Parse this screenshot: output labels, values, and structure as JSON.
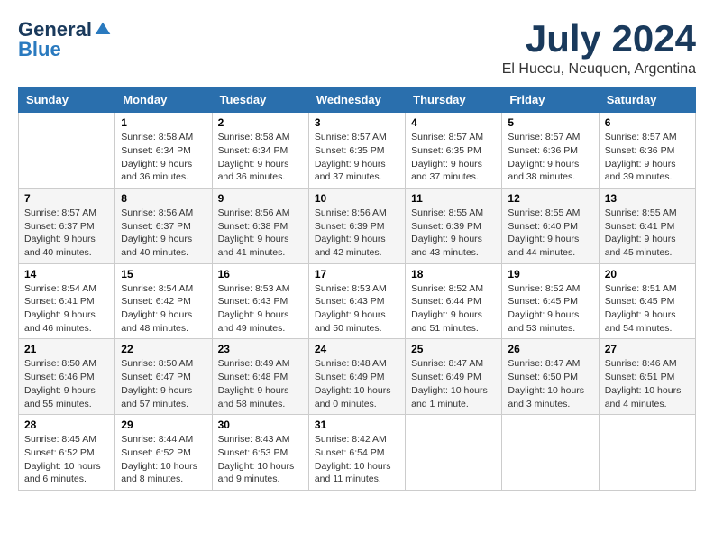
{
  "header": {
    "logo": {
      "general": "General",
      "blue": "Blue"
    },
    "title": "July 2024",
    "location": "El Huecu, Neuquen, Argentina"
  },
  "calendar": {
    "days_of_week": [
      "Sunday",
      "Monday",
      "Tuesday",
      "Wednesday",
      "Thursday",
      "Friday",
      "Saturday"
    ],
    "weeks": [
      [
        {
          "day": "",
          "info": ""
        },
        {
          "day": "1",
          "info": "Sunrise: 8:58 AM\nSunset: 6:34 PM\nDaylight: 9 hours\nand 36 minutes."
        },
        {
          "day": "2",
          "info": "Sunrise: 8:58 AM\nSunset: 6:34 PM\nDaylight: 9 hours\nand 36 minutes."
        },
        {
          "day": "3",
          "info": "Sunrise: 8:57 AM\nSunset: 6:35 PM\nDaylight: 9 hours\nand 37 minutes."
        },
        {
          "day": "4",
          "info": "Sunrise: 8:57 AM\nSunset: 6:35 PM\nDaylight: 9 hours\nand 37 minutes."
        },
        {
          "day": "5",
          "info": "Sunrise: 8:57 AM\nSunset: 6:36 PM\nDaylight: 9 hours\nand 38 minutes."
        },
        {
          "day": "6",
          "info": "Sunrise: 8:57 AM\nSunset: 6:36 PM\nDaylight: 9 hours\nand 39 minutes."
        }
      ],
      [
        {
          "day": "7",
          "info": "Sunrise: 8:57 AM\nSunset: 6:37 PM\nDaylight: 9 hours\nand 40 minutes."
        },
        {
          "day": "8",
          "info": "Sunrise: 8:56 AM\nSunset: 6:37 PM\nDaylight: 9 hours\nand 40 minutes."
        },
        {
          "day": "9",
          "info": "Sunrise: 8:56 AM\nSunset: 6:38 PM\nDaylight: 9 hours\nand 41 minutes."
        },
        {
          "day": "10",
          "info": "Sunrise: 8:56 AM\nSunset: 6:39 PM\nDaylight: 9 hours\nand 42 minutes."
        },
        {
          "day": "11",
          "info": "Sunrise: 8:55 AM\nSunset: 6:39 PM\nDaylight: 9 hours\nand 43 minutes."
        },
        {
          "day": "12",
          "info": "Sunrise: 8:55 AM\nSunset: 6:40 PM\nDaylight: 9 hours\nand 44 minutes."
        },
        {
          "day": "13",
          "info": "Sunrise: 8:55 AM\nSunset: 6:41 PM\nDaylight: 9 hours\nand 45 minutes."
        }
      ],
      [
        {
          "day": "14",
          "info": "Sunrise: 8:54 AM\nSunset: 6:41 PM\nDaylight: 9 hours\nand 46 minutes."
        },
        {
          "day": "15",
          "info": "Sunrise: 8:54 AM\nSunset: 6:42 PM\nDaylight: 9 hours\nand 48 minutes."
        },
        {
          "day": "16",
          "info": "Sunrise: 8:53 AM\nSunset: 6:43 PM\nDaylight: 9 hours\nand 49 minutes."
        },
        {
          "day": "17",
          "info": "Sunrise: 8:53 AM\nSunset: 6:43 PM\nDaylight: 9 hours\nand 50 minutes."
        },
        {
          "day": "18",
          "info": "Sunrise: 8:52 AM\nSunset: 6:44 PM\nDaylight: 9 hours\nand 51 minutes."
        },
        {
          "day": "19",
          "info": "Sunrise: 8:52 AM\nSunset: 6:45 PM\nDaylight: 9 hours\nand 53 minutes."
        },
        {
          "day": "20",
          "info": "Sunrise: 8:51 AM\nSunset: 6:45 PM\nDaylight: 9 hours\nand 54 minutes."
        }
      ],
      [
        {
          "day": "21",
          "info": "Sunrise: 8:50 AM\nSunset: 6:46 PM\nDaylight: 9 hours\nand 55 minutes."
        },
        {
          "day": "22",
          "info": "Sunrise: 8:50 AM\nSunset: 6:47 PM\nDaylight: 9 hours\nand 57 minutes."
        },
        {
          "day": "23",
          "info": "Sunrise: 8:49 AM\nSunset: 6:48 PM\nDaylight: 9 hours\nand 58 minutes."
        },
        {
          "day": "24",
          "info": "Sunrise: 8:48 AM\nSunset: 6:49 PM\nDaylight: 10 hours\nand 0 minutes."
        },
        {
          "day": "25",
          "info": "Sunrise: 8:47 AM\nSunset: 6:49 PM\nDaylight: 10 hours\nand 1 minute."
        },
        {
          "day": "26",
          "info": "Sunrise: 8:47 AM\nSunset: 6:50 PM\nDaylight: 10 hours\nand 3 minutes."
        },
        {
          "day": "27",
          "info": "Sunrise: 8:46 AM\nSunset: 6:51 PM\nDaylight: 10 hours\nand 4 minutes."
        }
      ],
      [
        {
          "day": "28",
          "info": "Sunrise: 8:45 AM\nSunset: 6:52 PM\nDaylight: 10 hours\nand 6 minutes."
        },
        {
          "day": "29",
          "info": "Sunrise: 8:44 AM\nSunset: 6:52 PM\nDaylight: 10 hours\nand 8 minutes."
        },
        {
          "day": "30",
          "info": "Sunrise: 8:43 AM\nSunset: 6:53 PM\nDaylight: 10 hours\nand 9 minutes."
        },
        {
          "day": "31",
          "info": "Sunrise: 8:42 AM\nSunset: 6:54 PM\nDaylight: 10 hours\nand 11 minutes."
        },
        {
          "day": "",
          "info": ""
        },
        {
          "day": "",
          "info": ""
        },
        {
          "day": "",
          "info": ""
        }
      ]
    ]
  }
}
